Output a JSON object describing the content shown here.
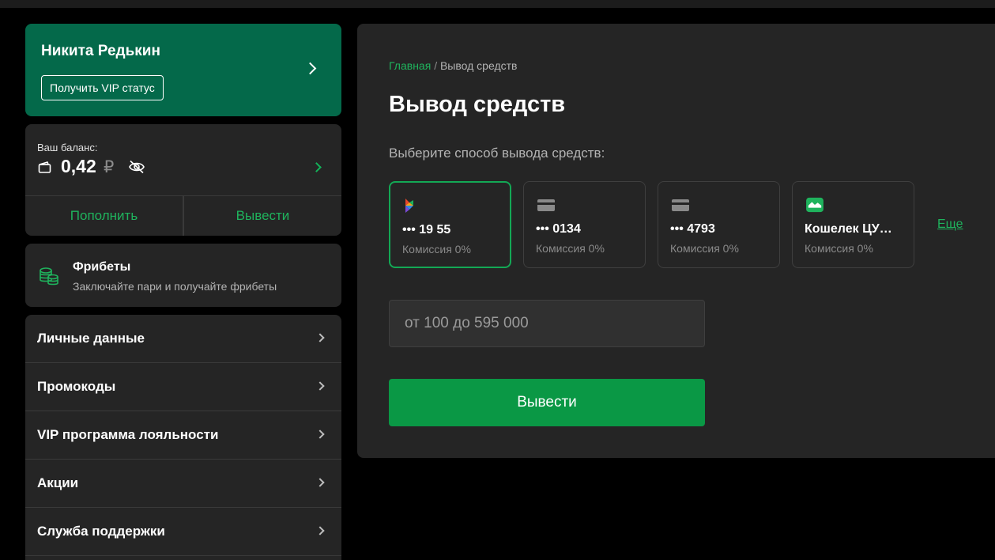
{
  "profile": {
    "name": "Никита Редькин",
    "vip_button": "Получить VIP статус"
  },
  "balance": {
    "label": "Ваш баланс:",
    "amount": "0,42",
    "currency": "₽",
    "deposit": "Пополнить",
    "withdraw": "Вывести"
  },
  "freebets": {
    "title": "Фрибеты",
    "subtitle": "Заключайте пари и получайте фрибеты"
  },
  "menu": {
    "items": [
      {
        "label": "Личные данные"
      },
      {
        "label": "Промокоды"
      },
      {
        "label": "VIP программа лояльности"
      },
      {
        "label": "Акции"
      },
      {
        "label": "Служба поддержки"
      }
    ]
  },
  "main": {
    "breadcrumb": {
      "home": "Главная",
      "separator": "/",
      "current": "Вывод средств"
    },
    "title": "Вывод средств",
    "method_prompt": "Выберите способ вывода средств:",
    "methods": [
      {
        "icon": "sbp-icon",
        "number": "••• 19 55",
        "fee": "Комиссия 0%",
        "selected": true
      },
      {
        "icon": "card-icon",
        "number": "••• 0134",
        "fee": "Комиссия 0%",
        "selected": false
      },
      {
        "icon": "card-icon",
        "number": "••• 4793",
        "fee": "Комиссия 0%",
        "selected": false
      },
      {
        "icon": "wallet-cupis-icon",
        "number": "Кошелек ЦУ…",
        "fee": "Комиссия 0%",
        "selected": false
      }
    ],
    "more_link": "Еще",
    "amount_placeholder": "от 100 до 595 000",
    "submit": "Вывести"
  },
  "colors": {
    "accent_green": "#1fb35d",
    "profile_bg": "#04694a",
    "button_green": "#0a9845",
    "panel_bg": "#252525"
  }
}
